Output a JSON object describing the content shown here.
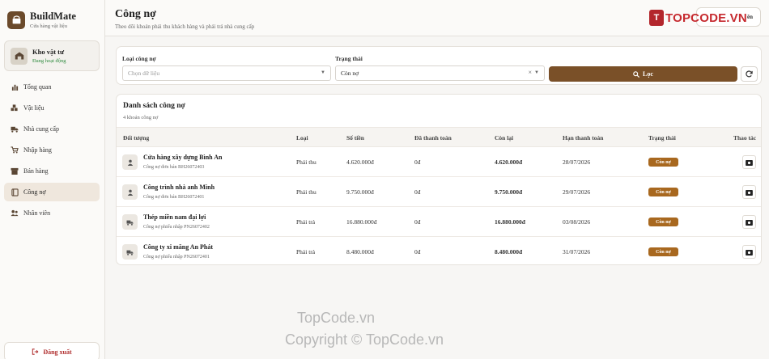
{
  "brand": {
    "name": "BuildMate",
    "subtitle": "Cửa hàng vật liệu"
  },
  "warehouse": {
    "name": "Kho vật tư",
    "status": "Đang hoạt động"
  },
  "sidebar": {
    "items": [
      {
        "label": "Tổng quan",
        "icon": "bar-chart-icon",
        "active": false
      },
      {
        "label": "Vật liệu",
        "icon": "boxes-icon",
        "active": false
      },
      {
        "label": "Nhà cung cấp",
        "icon": "truck-icon",
        "active": false
      },
      {
        "label": "Nhập hàng",
        "icon": "cart-icon",
        "active": false
      },
      {
        "label": "Bán hàng",
        "icon": "store-icon",
        "active": false
      },
      {
        "label": "Công nợ",
        "icon": "book-icon",
        "active": true
      },
      {
        "label": "Nhân viên",
        "icon": "users-icon",
        "active": false
      }
    ],
    "logout_label": "Đăng xuất"
  },
  "header": {
    "title": "Công nợ",
    "subtitle": "Theo dõi khoản phải thu khách hàng và phải trả nhà cung cấp",
    "user_label": "ên",
    "logo_mark": "T",
    "logo_word": "TOPCODE.VN"
  },
  "filters": {
    "type_label": "Loại công nợ",
    "type_placeholder": "Chọn dữ liệu",
    "status_label": "Trạng thái",
    "status_value": "Còn nợ",
    "clear_symbol": "×",
    "filter_button": "Lọc"
  },
  "list": {
    "title": "Danh sách công nợ",
    "count": "4 khoản công nợ",
    "columns": [
      "Đối tượng",
      "Loại",
      "Số tiền",
      "Đã thanh toán",
      "Còn lại",
      "Hạn thanh toán",
      "Trạng thái",
      "Thao tác"
    ],
    "rows": [
      {
        "name": "Cửa hàng xây dựng Bình An",
        "ref": "Công nợ đơn bán BH26072403",
        "kind": "Phải thu",
        "amount": "4.620.000đ",
        "paid": "0đ",
        "remaining": "4.620.000đ",
        "due": "28/07/2026",
        "status": "Còn nợ",
        "avatar": "person-icon"
      },
      {
        "name": "Công trình nhà anh Minh",
        "ref": "Công nợ đơn bán BH26072401",
        "kind": "Phải thu",
        "amount": "9.750.000đ",
        "paid": "0đ",
        "remaining": "9.750.000đ",
        "due": "29/07/2026",
        "status": "Còn nợ",
        "avatar": "person-icon"
      },
      {
        "name": "Thép miền nam đại lợi",
        "ref": "Công nợ phiếu nhập PN26072402",
        "kind": "Phải trả",
        "amount": "16.880.000đ",
        "paid": "0đ",
        "remaining": "16.880.000đ",
        "due": "03/08/2026",
        "status": "Còn nợ",
        "avatar": "truck-icon"
      },
      {
        "name": "Công ty xi măng An Phát",
        "ref": "Công nợ phiếu nhập PN26072401",
        "kind": "Phải trả",
        "amount": "8.480.000đ",
        "paid": "0đ",
        "remaining": "8.480.000đ",
        "due": "31/07/2026",
        "status": "Còn nợ",
        "avatar": "truck-icon"
      }
    ]
  },
  "watermark": {
    "line1": "TopCode.vn",
    "line2": "Copyright © TopCode.vn"
  },
  "colors": {
    "accent": "#7a5028",
    "badge": "#a8681f",
    "brand": "#6b4a2b",
    "logo_red": "#c62a2f"
  }
}
